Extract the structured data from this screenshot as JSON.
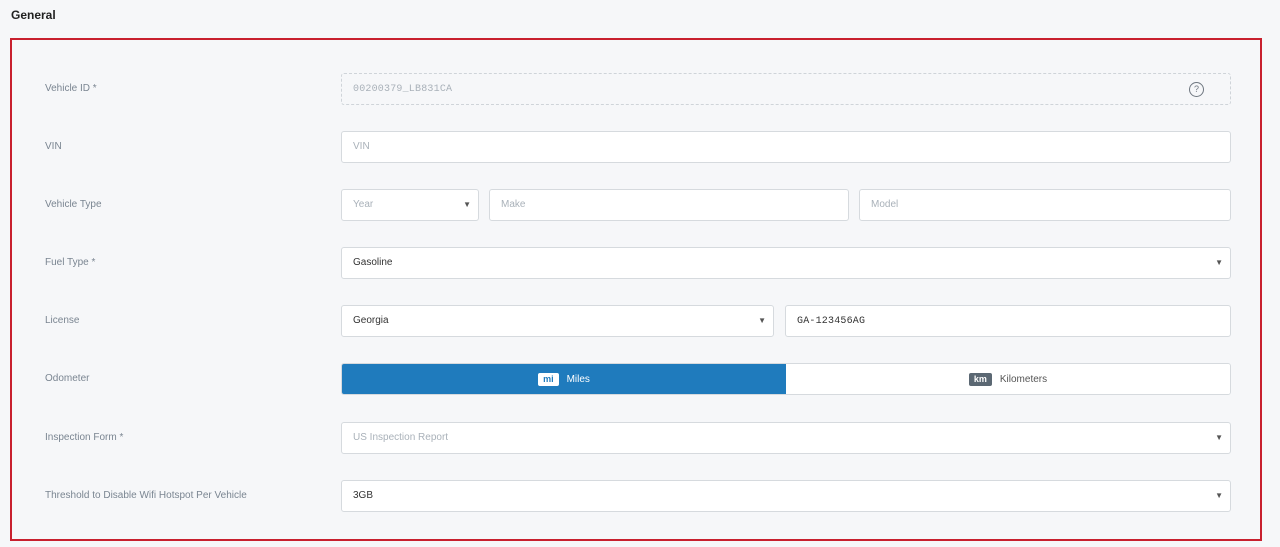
{
  "section": {
    "title": "General"
  },
  "fields": {
    "vehicle_id": {
      "label": "Vehicle ID *",
      "value": "00200379_LB831CA",
      "help_icon": "question-circle-icon"
    },
    "vin": {
      "label": "VIN",
      "placeholder": "VIN"
    },
    "vehicle_type": {
      "label": "Vehicle Type",
      "year_placeholder": "Year",
      "make_placeholder": "Make",
      "model_placeholder": "Model"
    },
    "fuel_type": {
      "label": "Fuel Type *",
      "value": "Gasoline"
    },
    "license": {
      "label": "License",
      "state": "Georgia",
      "plate": "GA-123456AG"
    },
    "odometer": {
      "label": "Odometer",
      "options": [
        {
          "badge": "mi",
          "label": "Miles",
          "selected": true
        },
        {
          "badge": "km",
          "label": "Kilometers",
          "selected": false
        }
      ]
    },
    "inspection_form": {
      "label": "Inspection Form *",
      "placeholder": "US Inspection Report"
    },
    "wifi_threshold": {
      "label": "Threshold to Disable Wifi Hotspot Per Vehicle",
      "value": "3GB"
    }
  },
  "icons": {
    "dropdown_caret": "▼",
    "help": "?"
  },
  "colors": {
    "accent": "#1f7bbd",
    "panel_border": "#c8202e"
  }
}
